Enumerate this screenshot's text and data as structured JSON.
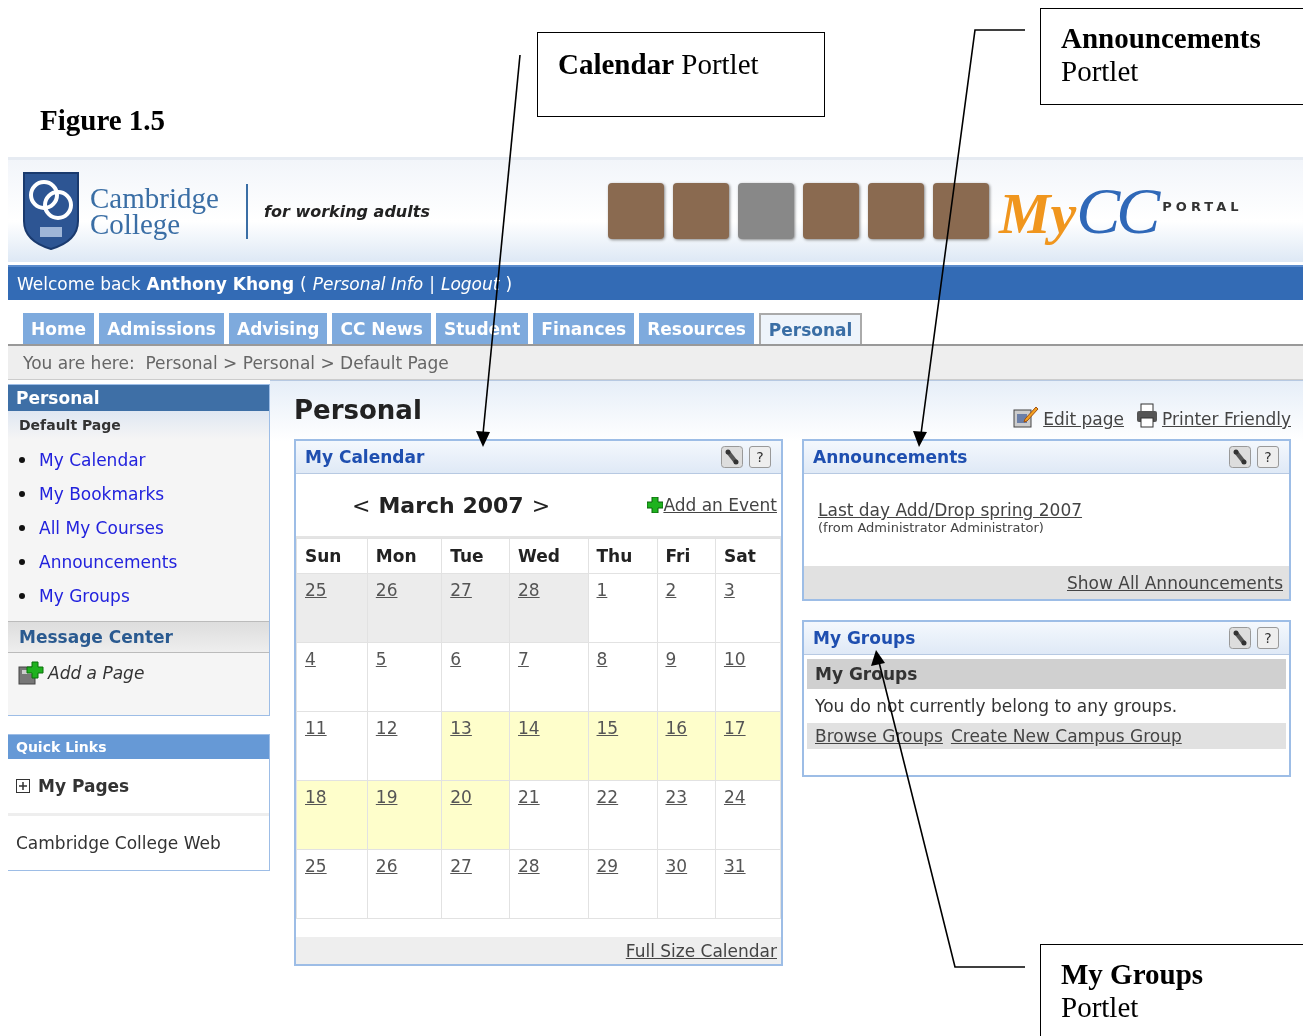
{
  "figure": {
    "caption": "Figure 1.5",
    "callouts": [
      {
        "title": "Calendar",
        "label": "Portlet"
      },
      {
        "title": "Announcements",
        "label": "Portlet"
      },
      {
        "title": "My Groups",
        "label": "Portlet"
      }
    ]
  },
  "header": {
    "college_name": "Cambridge College",
    "tagline": "for working adults",
    "photos": [
      {
        "grayscale": false
      },
      {
        "grayscale": false
      },
      {
        "grayscale": true
      },
      {
        "grayscale": false
      },
      {
        "grayscale": false
      },
      {
        "grayscale": false
      }
    ],
    "portal_logo": {
      "script": "My",
      "letters": "CC",
      "word": "PORTAL"
    }
  },
  "welcome_bar": {
    "greeting": "Welcome back",
    "user": "Anthony Khong",
    "open": "(",
    "links": [
      "Personal Info",
      "Logout"
    ],
    "separator": "|",
    "close": ")"
  },
  "tabs": [
    {
      "label": "Home",
      "selected": false
    },
    {
      "label": "Admissions",
      "selected": false
    },
    {
      "label": "Advising",
      "selected": false
    },
    {
      "label": "CC News",
      "selected": false
    },
    {
      "label": "Student",
      "selected": false
    },
    {
      "label": "Finances",
      "selected": false
    },
    {
      "label": "Resources",
      "selected": false
    },
    {
      "label": "Personal",
      "selected": true
    }
  ],
  "breadcrumb": "You are here:  Personal > Personal > Default Page",
  "sidebar": {
    "title": "Personal",
    "subtitle": "Default Page",
    "links": [
      "My Calendar",
      "My Bookmarks",
      "All My Courses",
      "Announcements",
      "My Groups"
    ],
    "message_center": "Message Center",
    "add_page": "Add a Page",
    "quick_links": {
      "title": "Quick Links",
      "items": [
        {
          "kind": "folder",
          "label": "My Pages",
          "expanded": false
        },
        {
          "kind": "link",
          "label": "Cambridge College Web"
        }
      ]
    }
  },
  "page": {
    "title": "Personal",
    "actions": [
      {
        "kind": "edit",
        "label": "Edit page"
      },
      {
        "kind": "print",
        "label": "Printer Friendly"
      }
    ]
  },
  "calendar": {
    "title": "My Calendar",
    "help": "?",
    "prev": "<",
    "month": "March 2007",
    "next": ">",
    "add_event": "Add an Event",
    "weekdays": [
      "Sun",
      "Mon",
      "Tue",
      "Wed",
      "Thu",
      "Fri",
      "Sat"
    ],
    "weeks": [
      [
        {
          "day": "25",
          "outside": true,
          "highlighted": false
        },
        {
          "day": "26",
          "outside": true,
          "highlighted": false
        },
        {
          "day": "27",
          "outside": true,
          "highlighted": false
        },
        {
          "day": "28",
          "outside": true,
          "highlighted": false
        },
        {
          "day": "1",
          "outside": false,
          "highlighted": false
        },
        {
          "day": "2",
          "outside": false,
          "highlighted": false
        },
        {
          "day": "3",
          "outside": false,
          "highlighted": false
        }
      ],
      [
        {
          "day": "4",
          "outside": false,
          "highlighted": false
        },
        {
          "day": "5",
          "outside": false,
          "highlighted": false
        },
        {
          "day": "6",
          "outside": false,
          "highlighted": false
        },
        {
          "day": "7",
          "outside": false,
          "highlighted": false
        },
        {
          "day": "8",
          "outside": false,
          "highlighted": false
        },
        {
          "day": "9",
          "outside": false,
          "highlighted": false
        },
        {
          "day": "10",
          "outside": false,
          "highlighted": false
        }
      ],
      [
        {
          "day": "11",
          "outside": false,
          "highlighted": false
        },
        {
          "day": "12",
          "outside": false,
          "highlighted": false
        },
        {
          "day": "13",
          "outside": false,
          "highlighted": true
        },
        {
          "day": "14",
          "outside": false,
          "highlighted": true
        },
        {
          "day": "15",
          "outside": false,
          "highlighted": true
        },
        {
          "day": "16",
          "outside": false,
          "highlighted": true
        },
        {
          "day": "17",
          "outside": false,
          "highlighted": true
        }
      ],
      [
        {
          "day": "18",
          "outside": false,
          "highlighted": true
        },
        {
          "day": "19",
          "outside": false,
          "highlighted": true
        },
        {
          "day": "20",
          "outside": false,
          "highlighted": true
        },
        {
          "day": "21",
          "outside": false,
          "highlighted": false
        },
        {
          "day": "22",
          "outside": false,
          "highlighted": false
        },
        {
          "day": "23",
          "outside": false,
          "highlighted": false
        },
        {
          "day": "24",
          "outside": false,
          "highlighted": false
        }
      ],
      [
        {
          "day": "25",
          "outside": false,
          "highlighted": false
        },
        {
          "day": "26",
          "outside": false,
          "highlighted": false
        },
        {
          "day": "27",
          "outside": false,
          "highlighted": false
        },
        {
          "day": "28",
          "outside": false,
          "highlighted": false
        },
        {
          "day": "29",
          "outside": false,
          "highlighted": false
        },
        {
          "day": "30",
          "outside": false,
          "highlighted": false
        },
        {
          "day": "31",
          "outside": false,
          "highlighted": false
        }
      ]
    ],
    "footer_link": "Full Size Calendar"
  },
  "announcements": {
    "title": "Announcements",
    "help": "?",
    "items": [
      {
        "title": "Last day Add/Drop spring 2007",
        "meta": "(from Administrator Administrator)"
      }
    ],
    "footer_link": "Show All Announcements"
  },
  "groups": {
    "title": "My Groups",
    "help": "?",
    "heading": "My Groups",
    "message": "You do not currently belong to any groups.",
    "links": [
      "Browse Groups",
      "Create New Campus Group"
    ]
  }
}
